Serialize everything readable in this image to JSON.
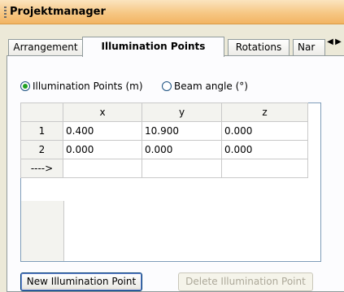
{
  "panel": {
    "title": "Projektmanager"
  },
  "tabs": [
    {
      "label": "Arrangement",
      "active": false
    },
    {
      "label": "Illumination Points",
      "active": true
    },
    {
      "label": "Rotations",
      "active": false
    },
    {
      "label": "Nar",
      "active": false
    }
  ],
  "tab_scroll": {
    "left_icon": "◀",
    "right_icon": "▶"
  },
  "unit_options": [
    {
      "label": "Illumination Points (m)",
      "checked": true
    },
    {
      "label": "Beam angle (°)",
      "checked": false
    }
  ],
  "grid": {
    "columns": [
      "x",
      "y",
      "z"
    ],
    "rows": [
      {
        "header": "1",
        "cells": [
          "0.400",
          "10.900",
          "0.000"
        ]
      },
      {
        "header": "2",
        "cells": [
          "0.000",
          "0.000",
          "0.000"
        ]
      },
      {
        "header": "---->",
        "cells": [
          "",
          "",
          ""
        ]
      }
    ]
  },
  "buttons": {
    "new_label": "New Illumination Point",
    "delete_label": "Delete Illumination Point"
  },
  "colors": {
    "header_gradient_bottom": "#f2b463",
    "radio_dot": "#21a121",
    "button_border": "#003c74"
  }
}
